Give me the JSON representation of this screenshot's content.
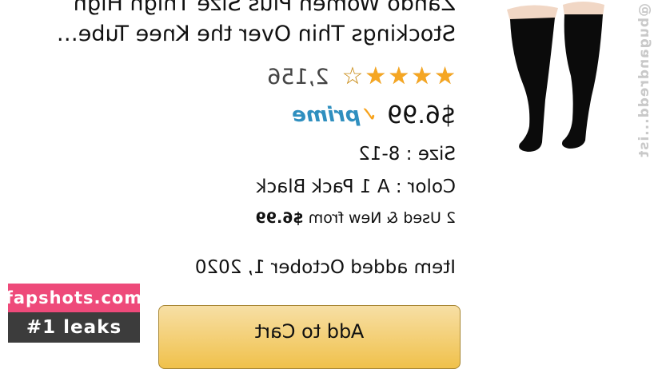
{
  "product": {
    "title_lines": [
      "Zando Women Plus Size Thigh High",
      "Stockings Thin Over the Knee Tube…"
    ],
    "rating": {
      "stars": 4,
      "out_of": 5,
      "count": "2,156"
    },
    "price": "$6.99",
    "prime": {
      "word": "prime",
      "icon": "prime-check-icon"
    },
    "size": "Size : 8-12",
    "color": "Color : A 1 Pack Black",
    "offers": {
      "text": "2 Used & New  from",
      "price": "$6.99"
    },
    "added": "Item added October 1, 2020",
    "image_icon": "thigh-high-stockings-image"
  },
  "actions": {
    "add_to_cart": "Add to Cart"
  },
  "watermarks": {
    "vertical": "@bugandredd...ist",
    "site": "fapshots.com",
    "tagline": "#1 leaks"
  },
  "colors": {
    "star": "#f5a623",
    "prime_blue": "#2f8fbf",
    "prime_check": "#f7a21b",
    "button": "#f0c14b",
    "badge_pink": "#ee4a7a",
    "badge_dark": "#3c3c3c"
  }
}
